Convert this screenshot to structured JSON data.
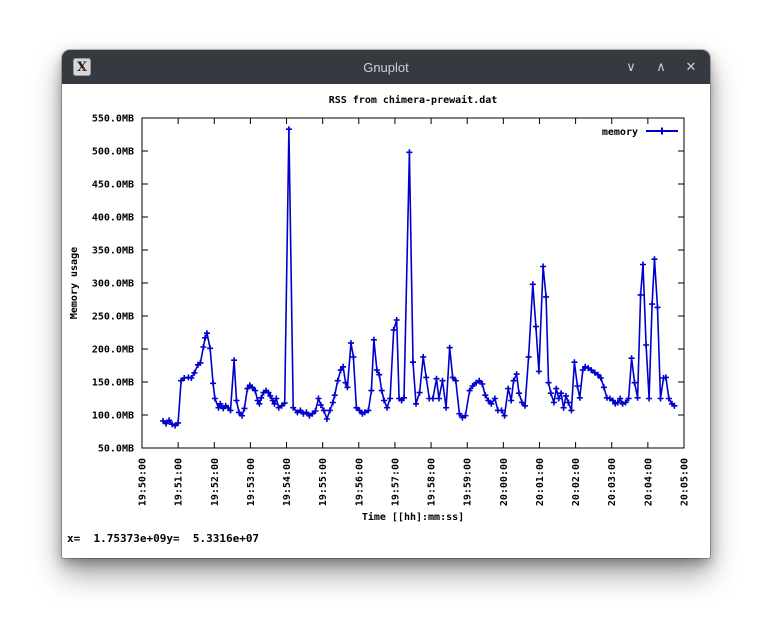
{
  "window": {
    "title": "Gnuplot",
    "icon_glyph": "X",
    "controls": {
      "minimize": "∨",
      "maximize": "∧",
      "close": "✕"
    }
  },
  "status": {
    "x_readout": "x=  1.75373e+09",
    "y_readout": "y=  5.3316e+07"
  },
  "colors": {
    "titlebar_bg": "#343a40",
    "titlebar_fg": "#cdd2d6",
    "plot_fg": "#000000",
    "series_blue": "#0000cc",
    "window_bg": "#ffffff"
  },
  "chart_data": {
    "type": "line",
    "title": "RSS from chimera-prewait.dat",
    "xlabel": "Time [[hh]:mm:ss]",
    "ylabel": "Memory usage",
    "grid": false,
    "legend_position": "top-right-inside",
    "ylim_mb": [
      50,
      550
    ],
    "x_base_time": "19:50:00",
    "x_range_sec": [
      0,
      900
    ],
    "y_tick_labels": [
      "550.0MB",
      "500.0MB",
      "450.0MB",
      "400.0MB",
      "350.0MB",
      "300.0MB",
      "250.0MB",
      "200.0MB",
      "150.0MB",
      "100.0MB",
      "50.0MB"
    ],
    "x_tick_labels": [
      "19:50:00",
      "19:51:00",
      "19:52:00",
      "19:53:00",
      "19:54:00",
      "19:55:00",
      "19:56:00",
      "19:57:00",
      "19:58:00",
      "19:59:00",
      "20:00:00",
      "20:01:00",
      "20:02:00",
      "20:03:00",
      "20:04:00",
      "20:05:00"
    ],
    "series": [
      {
        "name": "memory",
        "color": "#0000cc",
        "marker": "plus",
        "points_t_sec": [
          35,
          40,
          45,
          50,
          55,
          60,
          65,
          70,
          77,
          82,
          87,
          93,
          97,
          102,
          105,
          108,
          113,
          118,
          121,
          127,
          130,
          135,
          139,
          143,
          147,
          153,
          157,
          161,
          166,
          170,
          175,
          179,
          183,
          188,
          192,
          195,
          198,
          202,
          206,
          210,
          213,
          217,
          220,
          223,
          227,
          232,
          237,
          244,
          251,
          258,
          263,
          268,
          273,
          278,
          283,
          288,
          293,
          297,
          302,
          307,
          312,
          317,
          320,
          325,
          330,
          334,
          338,
          341,
          347,
          351,
          356,
          361,
          366,
          370,
          376,
          381,
          385,
          390,
          394,
          398,
          402,
          407,
          412,
          418,
          423,
          427,
          431,
          435,
          444,
          450,
          455,
          461,
          467,
          472,
          477,
          483,
          489,
          493,
          499,
          505,
          511,
          516,
          521,
          527,
          532,
          537,
          544,
          549,
          555,
          560,
          565,
          570,
          575,
          580,
          586,
          591,
          597,
          602,
          608,
          613,
          617,
          622,
          626,
          631,
          636,
          642,
          649,
          654,
          659,
          666,
          671,
          675,
          679,
          684,
          688,
          692,
          696,
          700,
          704,
          708,
          713,
          718,
          723,
          727,
          732,
          736,
          741,
          746,
          752,
          757,
          762,
          767,
          772,
          777,
          782,
          786,
          790,
          794,
          798,
          803,
          808,
          813,
          818,
          823,
          828,
          832,
          837,
          842,
          847,
          851,
          856,
          861,
          866,
          870,
          875,
          880,
          884
        ],
        "points_mb": [
          91,
          87,
          92,
          86,
          84,
          88,
          152,
          156,
          157,
          156,
          164,
          176,
          179,
          203,
          217,
          224,
          201,
          148,
          125,
          111,
          117,
          110,
          114,
          111,
          107,
          183,
          122,
          104,
          99,
          110,
          140,
          145,
          142,
          137,
          122,
          117,
          126,
          134,
          137,
          134,
          129,
          122,
          117,
          125,
          111,
          114,
          118,
          533,
          111,
          104,
          107,
          102,
          104,
          99,
          102,
          106,
          125,
          115,
          107,
          94,
          107,
          119,
          130,
          152,
          168,
          173,
          149,
          142,
          209,
          188,
          111,
          107,
          102,
          104,
          107,
          137,
          214,
          168,
          161,
          137,
          122,
          111,
          125,
          229,
          244,
          125,
          122,
          126,
          498,
          180,
          117,
          134,
          188,
          157,
          125,
          125,
          155,
          125,
          152,
          111,
          202,
          157,
          152,
          102,
          96,
          99,
          137,
          144,
          149,
          152,
          147,
          130,
          122,
          117,
          125,
          107,
          107,
          99,
          140,
          122,
          152,
          162,
          133,
          119,
          114,
          188,
          298,
          234,
          166,
          325,
          279,
          149,
          133,
          119,
          140,
          125,
          133,
          111,
          129,
          119,
          107,
          180,
          144,
          126,
          168,
          173,
          171,
          168,
          164,
          161,
          156,
          142,
          126,
          125,
          122,
          117,
          119,
          125,
          117,
          119,
          125,
          186,
          149,
          126,
          282,
          328,
          206,
          125,
          268,
          336,
          263,
          125,
          156,
          157,
          125,
          117,
          114
        ]
      }
    ]
  }
}
